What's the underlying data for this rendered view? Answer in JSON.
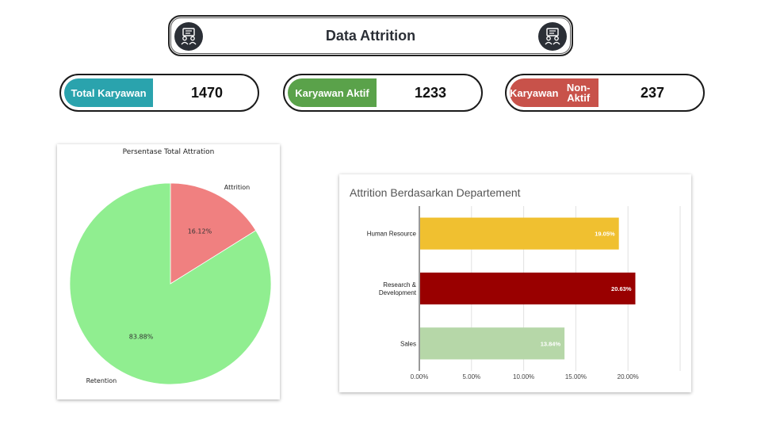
{
  "header": {
    "title": "Data Attrition",
    "left_icon": "people-presentation-icon",
    "right_icon": "people-presentation-icon"
  },
  "kpis": [
    {
      "label": "Total Karyawan",
      "value": "1470",
      "color": "#2aa3ad"
    },
    {
      "label": "Karyawan Aktif",
      "value": "1233",
      "color": "#5aa24a"
    },
    {
      "label": "Karyawan\nNon-Aktif",
      "value": "237",
      "color": "#c8524a"
    }
  ],
  "chart_data": [
    {
      "type": "pie",
      "title": "Persentase Total Attration",
      "labels": [
        "Attrition",
        "Retention"
      ],
      "values": [
        16.12,
        83.88
      ],
      "value_labels": [
        "16.12%",
        "83.88%"
      ],
      "colors": [
        "#f08080",
        "#90ee90"
      ]
    },
    {
      "type": "bar",
      "orientation": "horizontal",
      "title": "Attrition Berdasarkan Departement",
      "categories": [
        "Human Resource",
        "Research & Development",
        "Sales"
      ],
      "values": [
        19.05,
        20.63,
        13.84
      ],
      "value_labels": [
        "19.05%",
        "20.63%",
        "13.84%"
      ],
      "colors": [
        "#f0c030",
        "#990000",
        "#b6d7a8"
      ],
      "xlim": [
        0,
        25
      ],
      "xticks": [
        "0.00%",
        "5.00%",
        "10.00%",
        "15.00%",
        "20.00%"
      ]
    }
  ]
}
